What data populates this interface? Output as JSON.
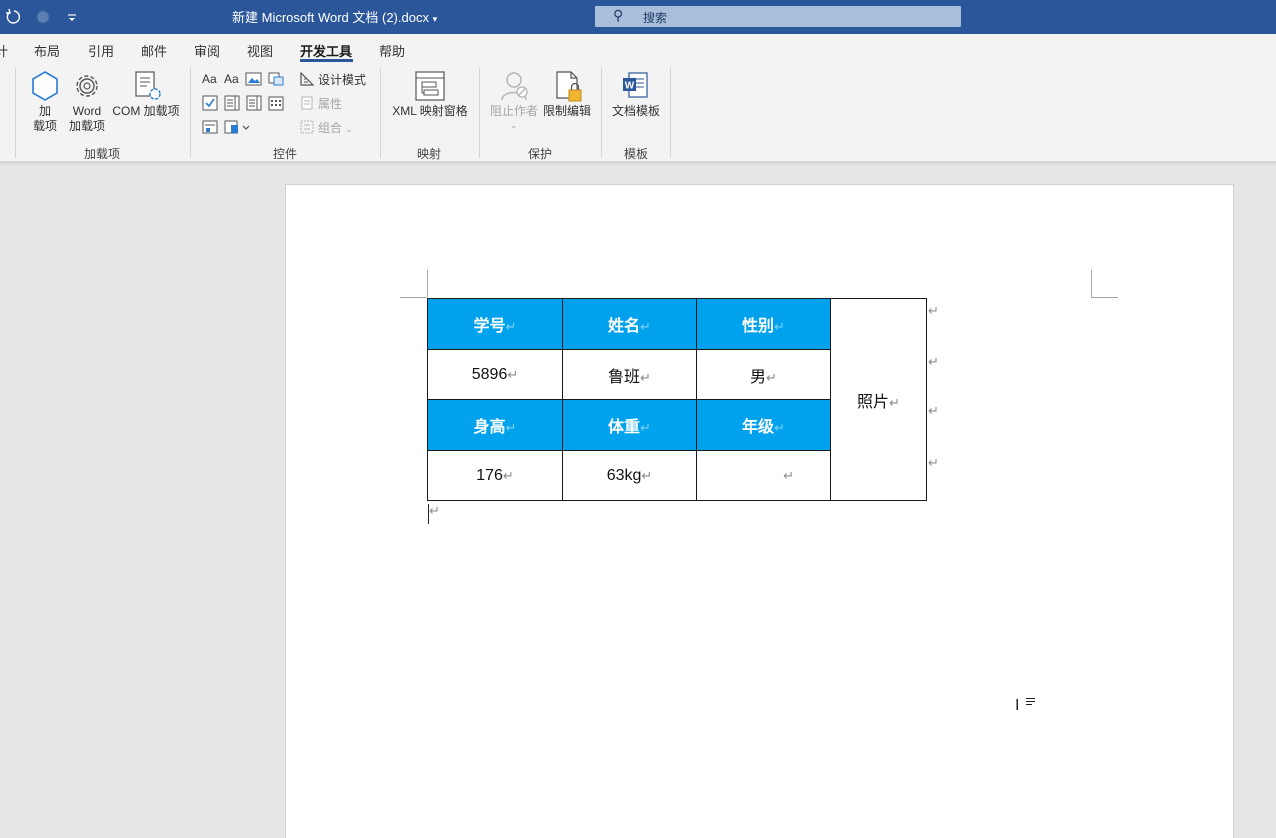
{
  "titlebar": {
    "title": "新建 Microsoft Word 文档 (2).docx",
    "title_arrow": "▾",
    "qa_icons": [
      "undo-icon",
      "autosave-icon",
      "customize-icon"
    ],
    "search_placeholder": "搜索"
  },
  "tabs": [
    {
      "label": "计",
      "name": "tab-design-partial"
    },
    {
      "label": "布局",
      "name": "tab-layout"
    },
    {
      "label": "引用",
      "name": "tab-references"
    },
    {
      "label": "邮件",
      "name": "tab-mailings"
    },
    {
      "label": "审阅",
      "name": "tab-review"
    },
    {
      "label": "视图",
      "name": "tab-view"
    },
    {
      "label": "开发工具",
      "name": "tab-developer",
      "active": true
    },
    {
      "label": "帮助",
      "name": "tab-help"
    }
  ],
  "ribbon": {
    "addins": {
      "label": "加载项",
      "addins_btn": "加\n载项",
      "word_addins_btn": "Word\n加载项",
      "com_addins_btn": "COM 加载项"
    },
    "controls": {
      "label": "控件",
      "design_mode": "设计模式",
      "properties": "属性",
      "group": "组合"
    },
    "mapping": {
      "label": "映射",
      "xml_pane": "XML 映射窗格"
    },
    "protect": {
      "label": "保护",
      "block_authors": "阻止作者",
      "restrict_editing": "限制编辑"
    },
    "templates": {
      "label": "模板",
      "doc_template": "文档模板"
    }
  },
  "document": {
    "paragraph_mark": "↵",
    "table": {
      "photo_label": "照片",
      "rows": [
        {
          "header": true,
          "cells": [
            "学号",
            "姓名",
            "性别"
          ]
        },
        {
          "header": false,
          "cells": [
            "5896",
            "鲁班",
            "男"
          ]
        },
        {
          "header": true,
          "cells": [
            "身高",
            "体重",
            "年级"
          ]
        },
        {
          "header": false,
          "cells": [
            "176",
            "63kg",
            ""
          ]
        }
      ]
    }
  },
  "colors": {
    "titlebar": "#2b579a",
    "table_header": "#00a2ed"
  }
}
